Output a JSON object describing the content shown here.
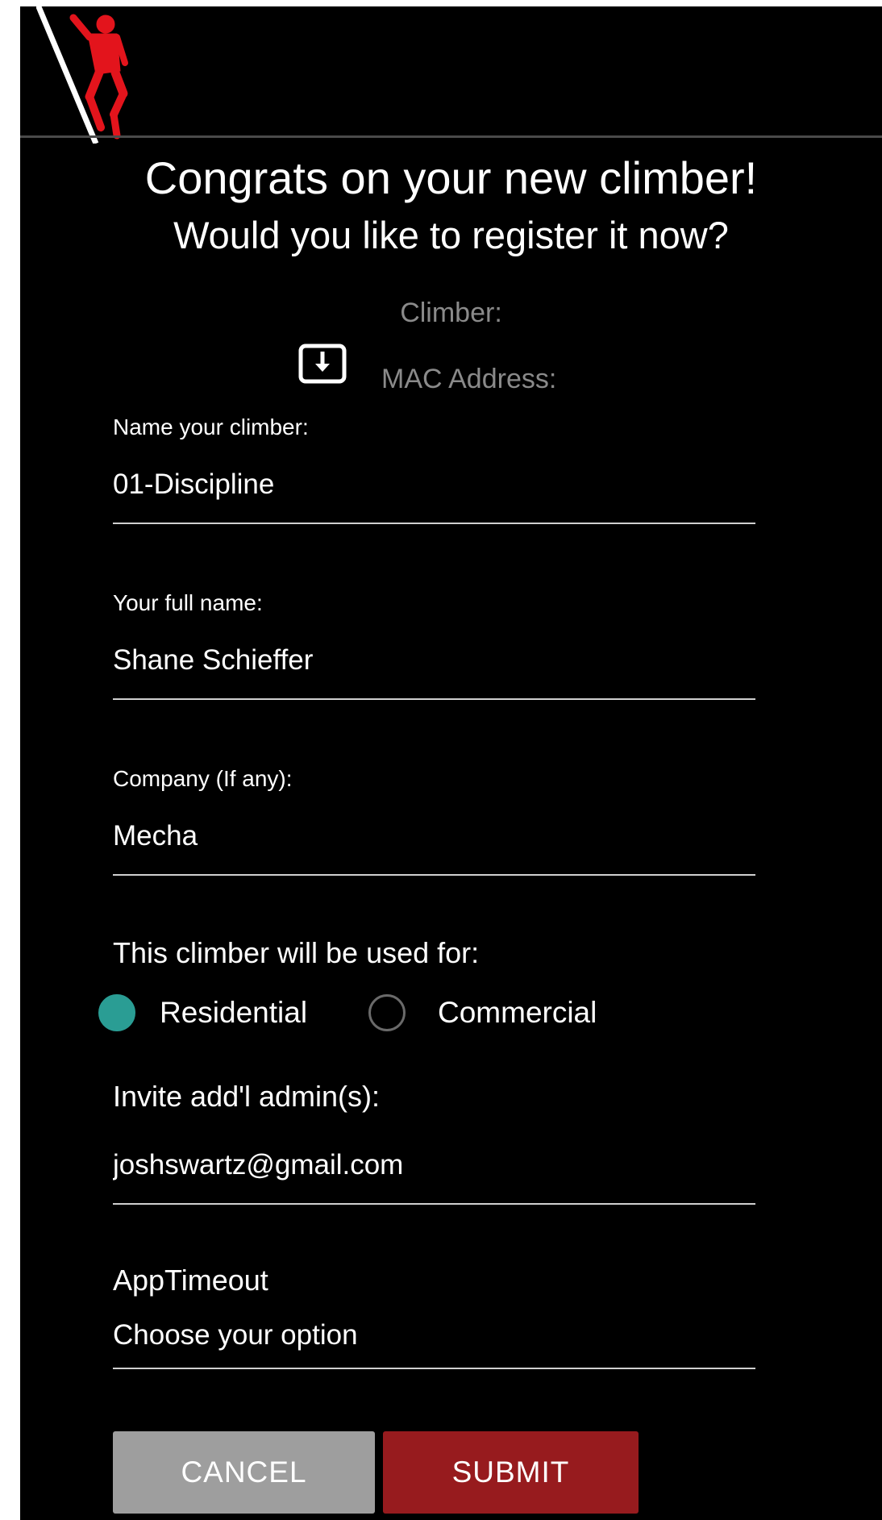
{
  "header": {
    "logo_icon": "climber-on-ladder-icon",
    "brand_color": "#e3141c"
  },
  "title": {
    "main": "Congrats on your new climber!",
    "sub": "Would you like to register it now?"
  },
  "device": {
    "climber_label": "Climber:",
    "mac_label": "MAC Address:",
    "download_icon": "download-box-icon"
  },
  "form": {
    "climber_name": {
      "label": "Name your climber:",
      "value": "01-Discipline"
    },
    "full_name": {
      "label": "Your full name:",
      "value": "Shane Schieffer"
    },
    "company": {
      "label": "Company (If any):",
      "value": "Mecha"
    },
    "usage": {
      "label": "This climber will be used for:",
      "options": [
        {
          "label": "Residential",
          "selected": true
        },
        {
          "label": "Commercial",
          "selected": false
        }
      ],
      "selected_color": "#2a9d94"
    },
    "admins": {
      "label": "Invite add'l admin(s):",
      "value": "joshswartz@gmail.com"
    },
    "app_timeout": {
      "label": "AppTimeout",
      "value": "Choose your option"
    }
  },
  "actions": {
    "cancel_label": "CANCEL",
    "submit_label": "SUBMIT",
    "cancel_color": "#9e9e9e",
    "submit_color": "#971b1e"
  }
}
